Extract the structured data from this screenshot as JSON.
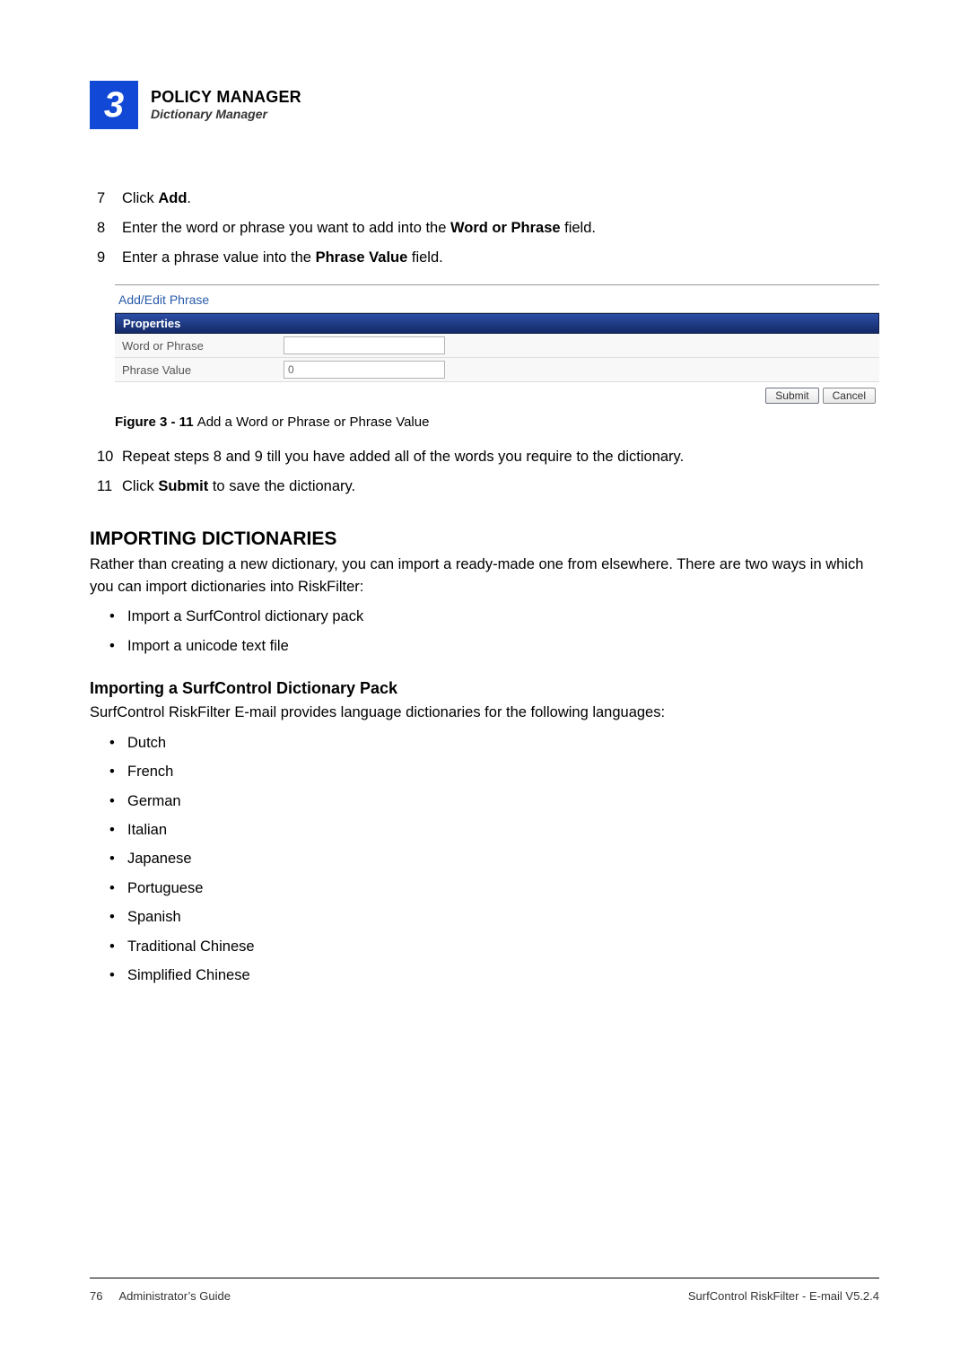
{
  "header": {
    "chapter_number": "3",
    "title_a": "P",
    "title_b": "OLICY",
    "title_c": " M",
    "title_d": "ANAGER",
    "subtitle": "Dictionary Manager"
  },
  "steps_a": [
    {
      "n": "7",
      "html": "Click <b>Add</b>."
    },
    {
      "n": "8",
      "html": "Enter the word or phrase you want to add into the <b>Word or Phrase</b> field."
    },
    {
      "n": "9",
      "html": "Enter a phrase value into the <b>Phrase Value</b> field."
    }
  ],
  "figure": {
    "panel_title": "Add/Edit Phrase",
    "prop_header": "Properties",
    "row1_label": "Word or Phrase",
    "row1_value": "",
    "row2_label": "Phrase Value",
    "row2_value": "0",
    "submit": "Submit",
    "cancel": "Cancel",
    "caption_bold": "Figure 3 - 11 ",
    "caption_rest": "Add a Word or Phrase or Phrase Value"
  },
  "steps_b": [
    {
      "n": "10",
      "html": "Repeat steps 8 and 9 till you have added all of the words you require to the dictionary."
    },
    {
      "n": "11",
      "html": "Click <b>Submit</b> to save the dictionary."
    }
  ],
  "section2": {
    "title_a": "I",
    "title_b": "MPORTING",
    "title_c": " D",
    "title_d": "ICTIONARIES",
    "intro": "Rather than creating a new dictionary, you can import a ready-made one from elsewhere. There are two ways in which you can import dictionaries into RiskFilter:",
    "import_ways": [
      "Import a SurfControl dictionary pack",
      "Import a unicode text file"
    ],
    "sub_title": "Importing a SurfControl Dictionary Pack",
    "sub_intro": "SurfControl RiskFilter E-mail provides language dictionaries for the following languages:",
    "languages": [
      "Dutch",
      "French",
      "German",
      "Italian",
      "Japanese",
      "Portuguese",
      "Spanish",
      "Traditional Chinese",
      "Simplified Chinese"
    ]
  },
  "footer": {
    "page": "76",
    "guide": "Administrator’s Guide",
    "product": "SurfControl RiskFilter - E-mail V5.2.4"
  }
}
